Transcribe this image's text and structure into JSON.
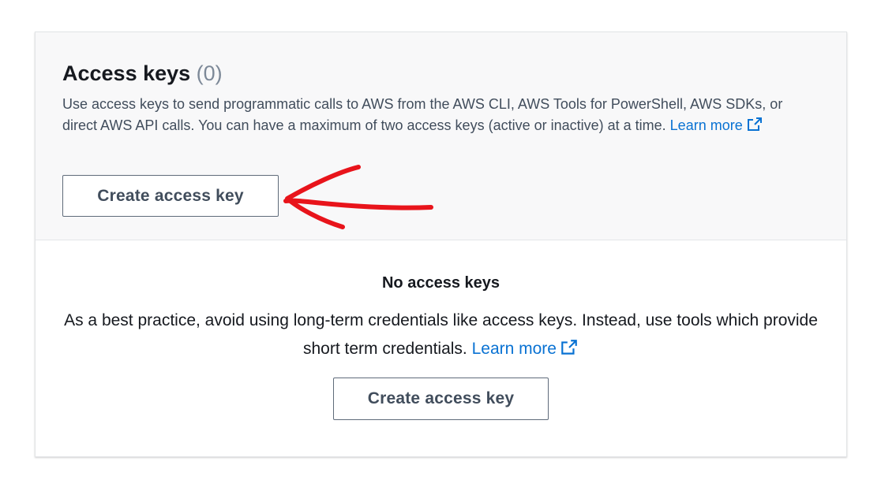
{
  "access_keys": {
    "title": "Access keys",
    "count": "(0)",
    "description": "Use access keys to send programmatic calls to AWS from the AWS CLI, AWS Tools for PowerShell, AWS SDKs, or direct AWS API calls. You can have a maximum of two access keys (active or inactive) at a time.",
    "learn_more": "Learn more",
    "create_button": "Create access key"
  },
  "empty_state": {
    "title": "No access keys",
    "description": "As a best practice, avoid using long-term credentials like access keys. Instead, use tools which provide short term credentials.",
    "learn_more": "Learn more",
    "create_button": "Create access key"
  },
  "annotation": {
    "color": "#e8141b",
    "icon": "red-arrow-icon"
  },
  "colors": {
    "link": "#0972d3",
    "header_bg": "#f8f8f9",
    "count": "#7d8998"
  }
}
